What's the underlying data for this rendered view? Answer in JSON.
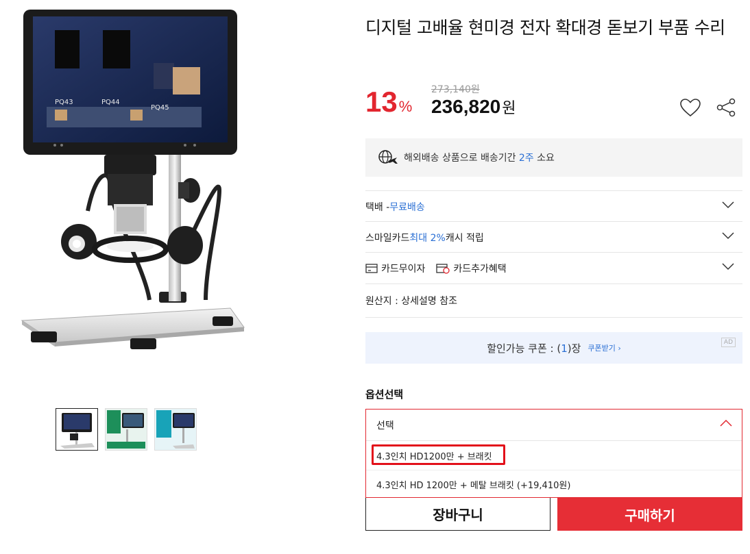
{
  "product": {
    "title": "디지털 고배율 현미경 전자 확대경 돋보기 부품 수리",
    "discount": "13",
    "discount_unit": "%",
    "original_price": "273,140원",
    "sale_price": "236,820",
    "sale_currency": "원",
    "image_labels": [
      "PQ43",
      "PQ44",
      "PQ45"
    ]
  },
  "notice": {
    "icon": "overseas-shipping-icon",
    "text_before": "해외배송 상품으로 배송기간 ",
    "highlight": "2주",
    "text_after": " 소요"
  },
  "shipping": {
    "label": "택배 - ",
    "highlight": "무료배송"
  },
  "card_point": {
    "label": "스마일카드 ",
    "highlight": "최대 2%",
    "after": " 캐시 적립"
  },
  "card_benefits": {
    "installment": "카드무이자",
    "extra": "카드추가혜택"
  },
  "origin": "원산지 : 상세설명 참조",
  "coupon": {
    "before": "할인가능 쿠폰 : (",
    "count": "1",
    "after": ")장",
    "get_label": "쿠폰받기 ›",
    "ad": "AD"
  },
  "option": {
    "title": "옵션선택",
    "placeholder": "선택",
    "items": [
      "4.3인치 HD1200만 + 브래킷",
      "4.3인치 HD 1200만 + 메탈 브래킷 (+19,410원)"
    ]
  },
  "actions": {
    "cart": "장바구니",
    "buy": "구매하기"
  },
  "colors": {
    "accent_red": "#e2262f",
    "link_blue": "#2a6fd4"
  }
}
